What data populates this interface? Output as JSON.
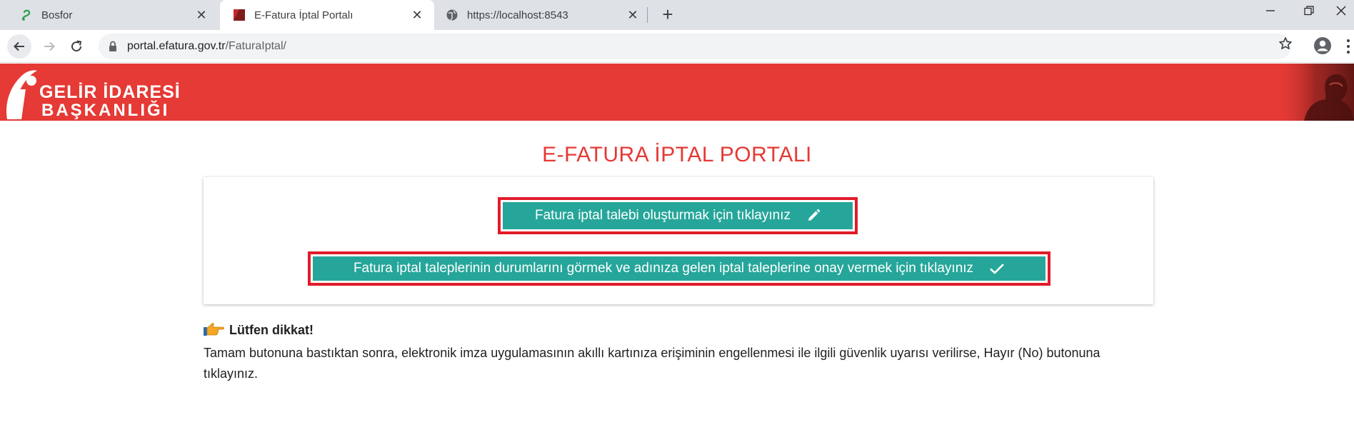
{
  "browser": {
    "tabs": [
      {
        "title": "Bosfor",
        "icon": "bosfor-favicon-icon",
        "active": false
      },
      {
        "title": "E-Fatura İptal Portalı",
        "icon": "efatura-favicon-icon",
        "active": true
      },
      {
        "title": "https://localhost:8543",
        "icon": "globe-icon",
        "active": false
      }
    ],
    "close_glyph": "✕",
    "new_tab_glyph": "+",
    "window_controls": {
      "minimize": "—",
      "restore": "❐",
      "close": "✕"
    },
    "url_domain": "portal.efatura.gov.tr",
    "url_path": "/FaturaIptal/"
  },
  "banner": {
    "logo_line1": "GELİR İDARESİ",
    "logo_line2": "BAŞKANLIĞI",
    "background_color": "#e53a35"
  },
  "main": {
    "title": "E-FATURA İPTAL PORTALI",
    "create_button_label": "Fatura iptal talebi oluşturmak için tıklayınız",
    "status_button_label": "Fatura iptal taleplerinin durumlarını görmek ve adınıza gelen iptal taleplerine onay vermek için tıklayınız",
    "button_color": "#26a69a",
    "highlight_color": "#e11c2a"
  },
  "notice": {
    "heading": "Lütfen dikkat!",
    "body": "Tamam butonuna bastıktan sonra, elektronik imza uygulamasının akıllı kartınıza erişiminin engellenmesi ile ilgili güvenlik uyarısı verilirse, Hayır (No) butonuna tıklayınız."
  }
}
